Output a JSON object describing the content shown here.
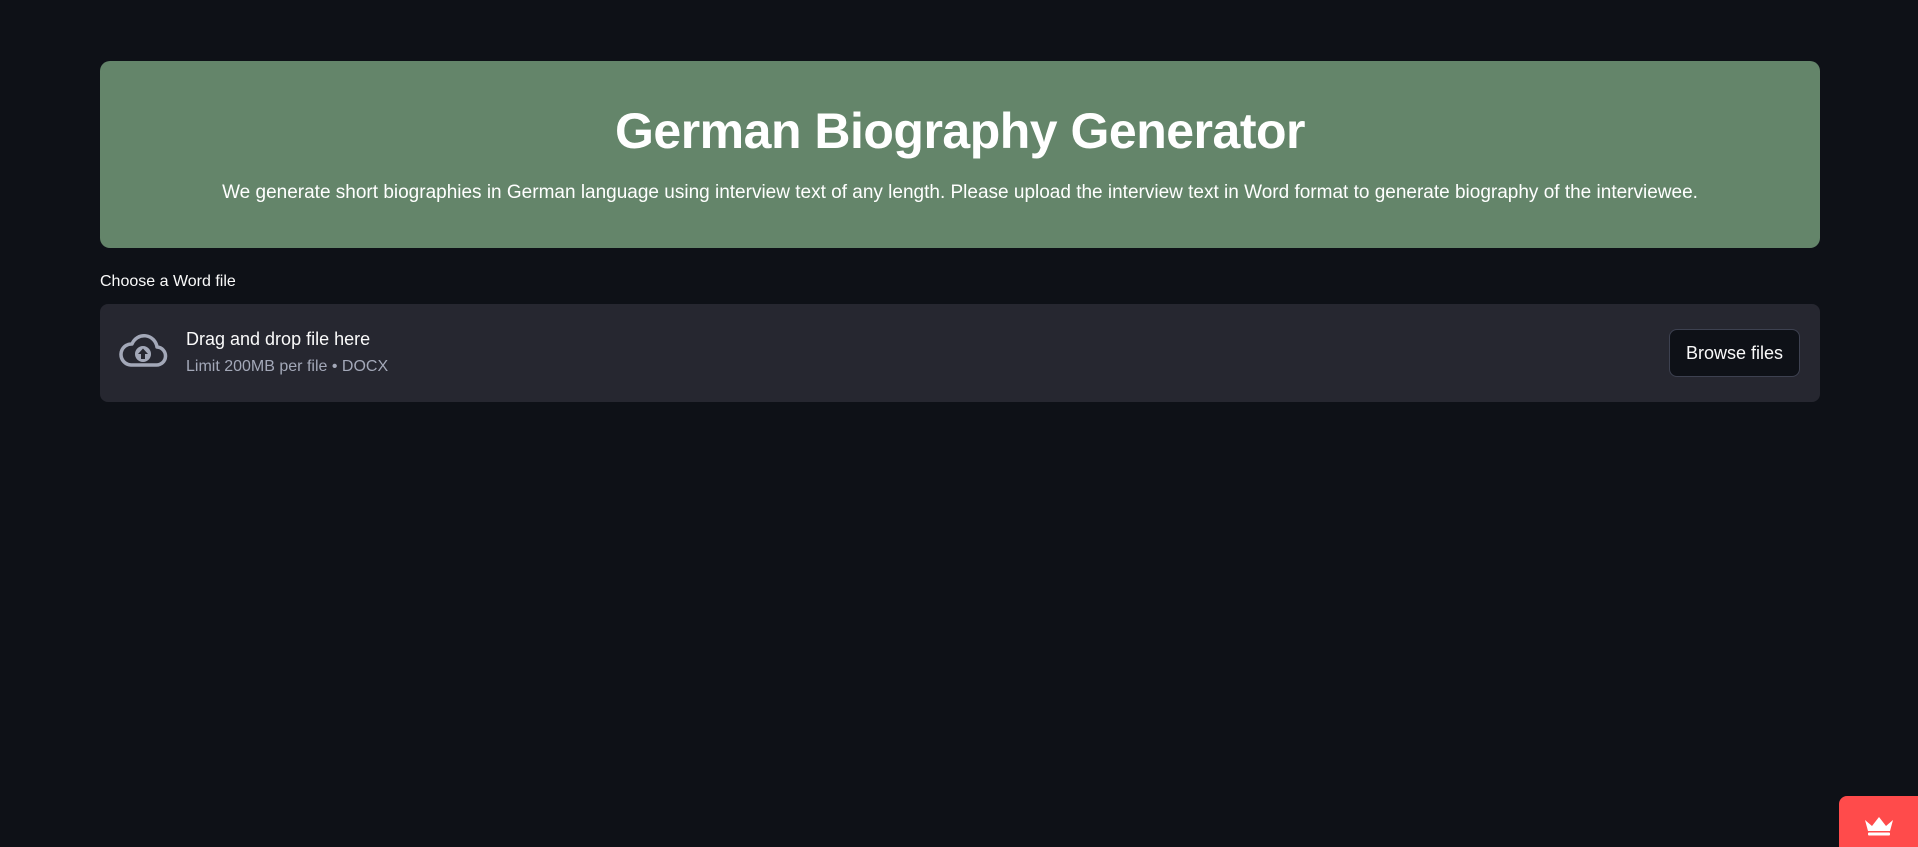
{
  "header": {
    "title": "German Biography Generator",
    "description": "We generate short biographies in German language using interview text of any length. Please upload the interview text in Word format to generate biography of the interviewee."
  },
  "uploader": {
    "label": "Choose a Word file",
    "drop_text": "Drag and drop file here",
    "limit_text": "Limit 200MB per file • DOCX",
    "browse_label": "Browse files",
    "icon": "cloud-upload-icon"
  },
  "badge": {
    "icon": "crown-icon"
  },
  "colors": {
    "background": "#0e1117",
    "banner": "#64856a",
    "dropzone": "#262730",
    "badge": "#ff4b4b"
  }
}
